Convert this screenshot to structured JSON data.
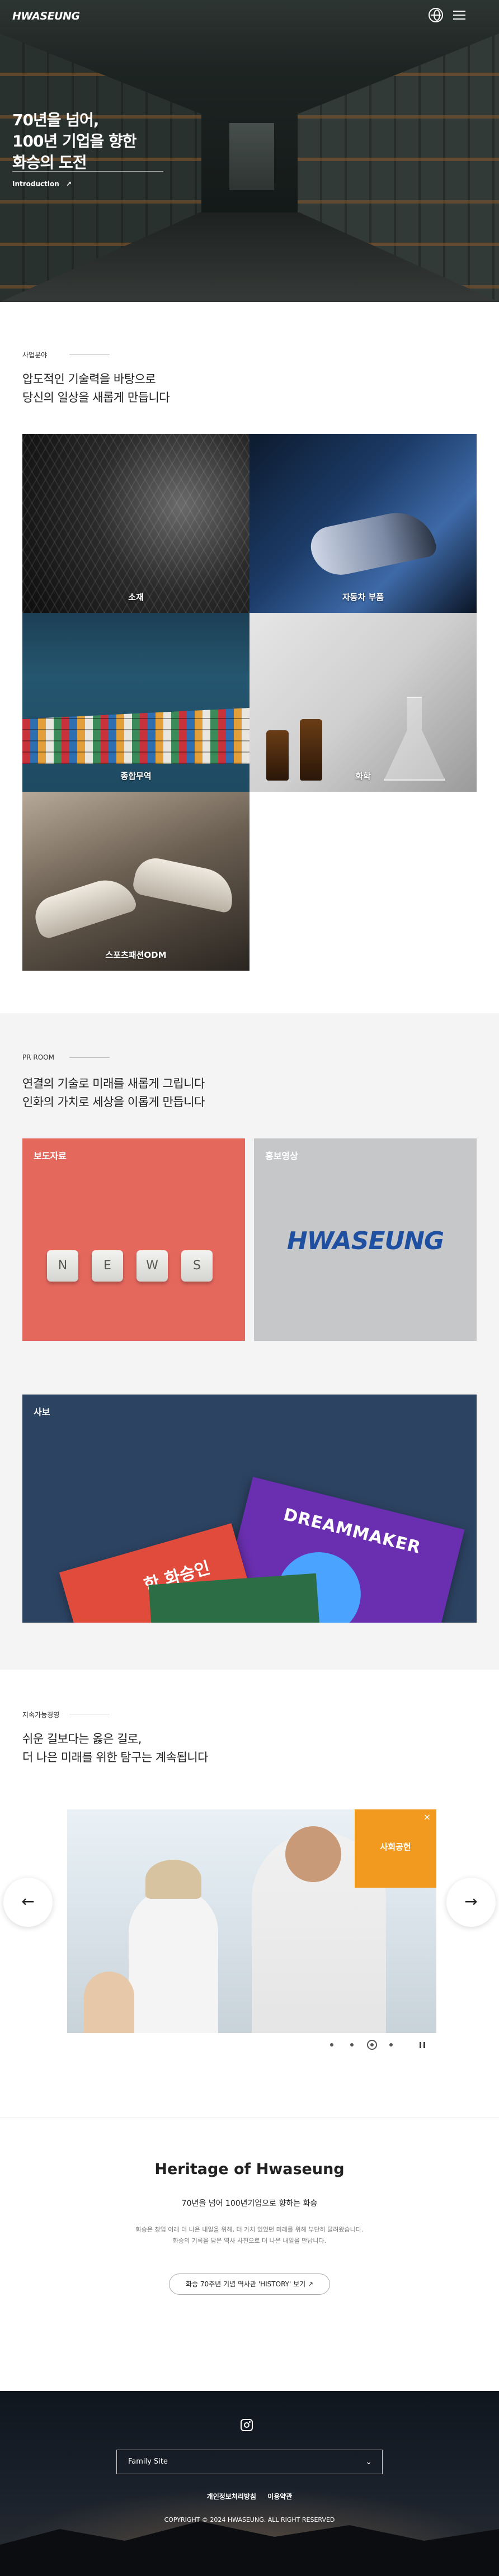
{
  "header": {
    "logo": "HWASEUNG",
    "globe_icon": "globe-icon",
    "menu_icon": "hamburger-menu-icon"
  },
  "hero": {
    "title_line1": "70년을 넘어,",
    "title_line2": "100년 기업을 향한",
    "title_line3": "화승의 도전",
    "link_label": "Introduction",
    "link_arrow": "↗"
  },
  "business": {
    "label": "사업분야",
    "title_line1": "압도적인 기술력을 바탕으로",
    "title_line2": "당신의 일상을 새롭게 만듭니다",
    "tiles": [
      {
        "label": "소재"
      },
      {
        "label": "자동차 부품"
      },
      {
        "label": "종합무역"
      },
      {
        "label": "화학"
      },
      {
        "label": "스포츠패션ODM"
      }
    ]
  },
  "pr": {
    "label": "PR ROOM",
    "title_line1": "연결의 기술로 미래를 새롭게 그립니다",
    "title_line2": "인화의 가치로 세상을 이롭게 만듭니다",
    "cards": [
      {
        "label": "보도자료",
        "keys": [
          "N",
          "E",
          "W",
          "S"
        ]
      },
      {
        "label": "홍보영상",
        "mark": "HWASEUNG"
      },
      {
        "label": "사보",
        "magazine_title": "DREAMMAKER",
        "magazine_title_2": "한 화승인"
      }
    ]
  },
  "sustainability": {
    "label": "지속가능경영",
    "title_line1": "쉬운 길보다는 옳은 길로,",
    "title_line2": "더 나은 미래를 위한 탐구는 계속됩니다",
    "slide_badge": "사회공헌",
    "badge_close": "×",
    "prev_label": "←",
    "next_label": "→",
    "dots_count": 5,
    "active_dot": 2
  },
  "heritage": {
    "title": "Heritage of Hwaseung",
    "subtitle": "70년을 넘어 100년기업으로 향하는 화승",
    "desc_line1": "화승은 창업 이래 더 나은 내일을 위해, 더 가치 있었던 미래를 위해 부단히 달려왔습니다.",
    "desc_line2": "화승의 기록을 담은 역사 사진으로 더 나은 내일을 만납니다.",
    "button_label": "화승 70주년 기념 역사관 'HISTORY' 보기 ↗"
  },
  "footer": {
    "instagram_icon": "instagram-icon",
    "family_site": "Family Site",
    "family_chevron": "⌄",
    "links": [
      "개인정보처리방침",
      "이용약관"
    ],
    "copyright": "COPYRIGHT © 2024 HWASEUNG. ALL RIGHT RESERVED"
  }
}
